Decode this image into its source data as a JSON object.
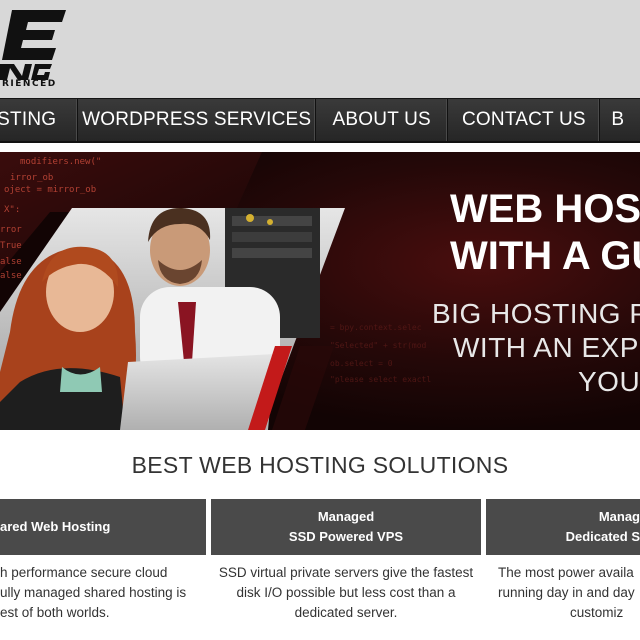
{
  "logo": {
    "tagline": "RIENCED",
    "icon": "brand-logo"
  },
  "nav": {
    "items": [
      {
        "label": "OSTING"
      },
      {
        "label": "WORDPRESS SERVICES"
      },
      {
        "label": "ABOUT US"
      },
      {
        "label": "CONTACT US"
      },
      {
        "label": "B"
      }
    ]
  },
  "hero": {
    "title_line1": "WEB HOS",
    "title_line2": "WITH A GU",
    "sub_line1": "BIG HOSTING P",
    "sub_line2": "WITH AN EXP",
    "sub_line3": "YOU"
  },
  "section": {
    "title": "BEST WEB HOSTING SOLUTIONS"
  },
  "plans": [
    {
      "title_line1": "",
      "title_line2": "ared Web Hosting",
      "desc": [
        "h performance secure cloud",
        "ully managed shared hosting is",
        "est of both worlds."
      ]
    },
    {
      "title_line1": "Managed",
      "title_line2": "SSD Powered VPS",
      "desc": [
        "SSD virtual private servers give the fastest",
        "disk I/O possible but less cost than a",
        "dedicated server."
      ]
    },
    {
      "title_line1": "Manag",
      "title_line2": "Dedicated S",
      "desc": [
        "The most power availa",
        "running day in and day",
        "customiz"
      ]
    }
  ],
  "colors": {
    "header_bg": "#d8d8d8",
    "nav_bg": "#2e2e2e",
    "hero_bg": "#170707",
    "accent_red": "#c31a1a",
    "plan_head_bg": "#4a4a4a"
  }
}
